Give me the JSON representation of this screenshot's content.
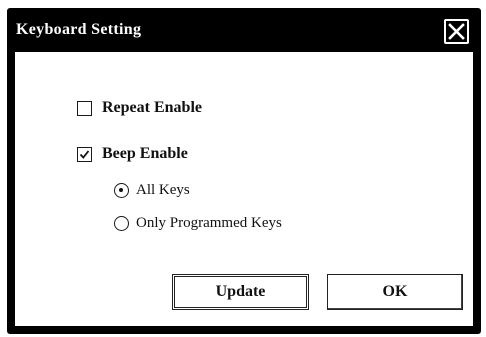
{
  "dialog": {
    "title": "Keyboard Setting",
    "close_icon": "close-x-icon"
  },
  "options": {
    "repeat_enable": {
      "label": "Repeat Enable",
      "checked": false
    },
    "beep_enable": {
      "label": "Beep Enable",
      "checked": true
    }
  },
  "beep_mode": {
    "selected": "all_keys",
    "all_keys": {
      "label": "All Keys"
    },
    "only_programmed_keys": {
      "label": "Only Programmed Keys"
    }
  },
  "buttons": {
    "update_label": "Update",
    "ok_label": "OK"
  },
  "colors": {
    "titlebar": "#000000",
    "title_text": "#ffffff",
    "client_background": "#ffffff"
  }
}
